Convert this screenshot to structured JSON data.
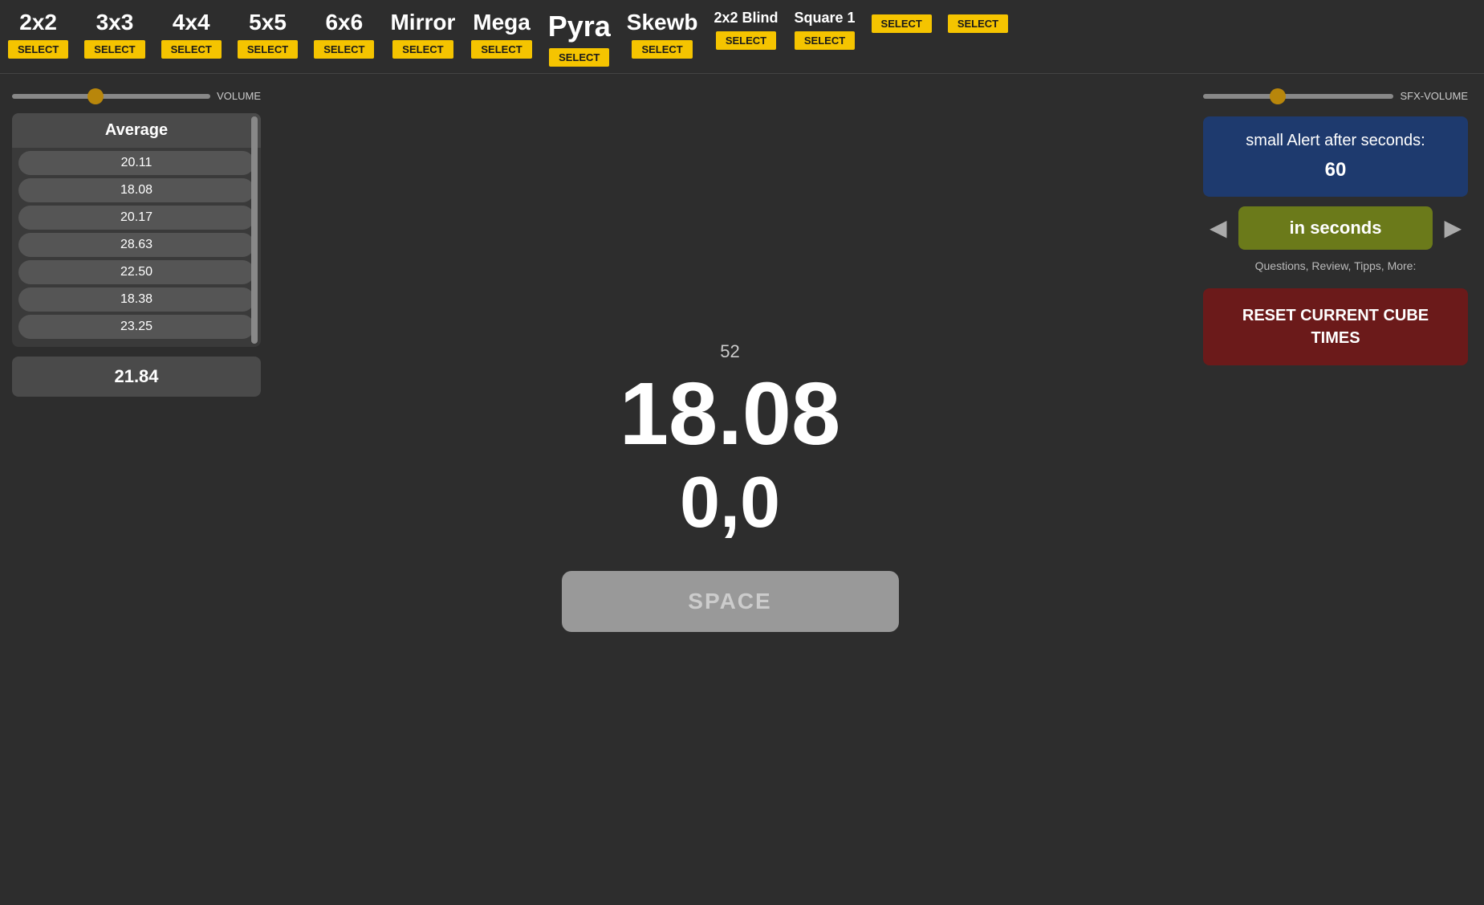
{
  "nav": {
    "items": [
      {
        "label": "2x2",
        "select": "SELECT"
      },
      {
        "label": "3x3",
        "select": "SELECT"
      },
      {
        "label": "4x4",
        "select": "SELECT"
      },
      {
        "label": "5x5",
        "select": "SELECT"
      },
      {
        "label": "6x6",
        "select": "SELECT"
      },
      {
        "label": "Mirror",
        "select": "SELECT"
      },
      {
        "label": "Mega",
        "select": "SELECT"
      },
      {
        "label": "Pyra",
        "select": "SELECT"
      },
      {
        "label": "Skewb",
        "select": "SELECT"
      },
      {
        "label": "2x2 Blind",
        "select": "SELECT"
      },
      {
        "label": "Square 1",
        "select": "SELECT"
      },
      {
        "label": "",
        "select": "SELECT"
      },
      {
        "label": "",
        "select": "SELECT"
      }
    ]
  },
  "left": {
    "volume_label": "VOLUME",
    "average_label": "Average",
    "times": [
      "20.11",
      "18.08",
      "20.17",
      "28.63",
      "22.50",
      "18.38",
      "23.25"
    ],
    "average_value": "21.84"
  },
  "center": {
    "solve_count": "52",
    "main_time": "18.08",
    "split_time": "0,0",
    "space_label": "SPACE"
  },
  "right": {
    "sfx_label": "SFX-VOLUME",
    "alert_title": "small Alert after seconds:",
    "alert_value": "60",
    "seconds_label": "in seconds",
    "questions_text": "Questions, Review, Tipps, More:",
    "reset_label": "RESET CURRENT CUBE TIMES",
    "arrow_left": "◀",
    "arrow_right": "▶"
  }
}
